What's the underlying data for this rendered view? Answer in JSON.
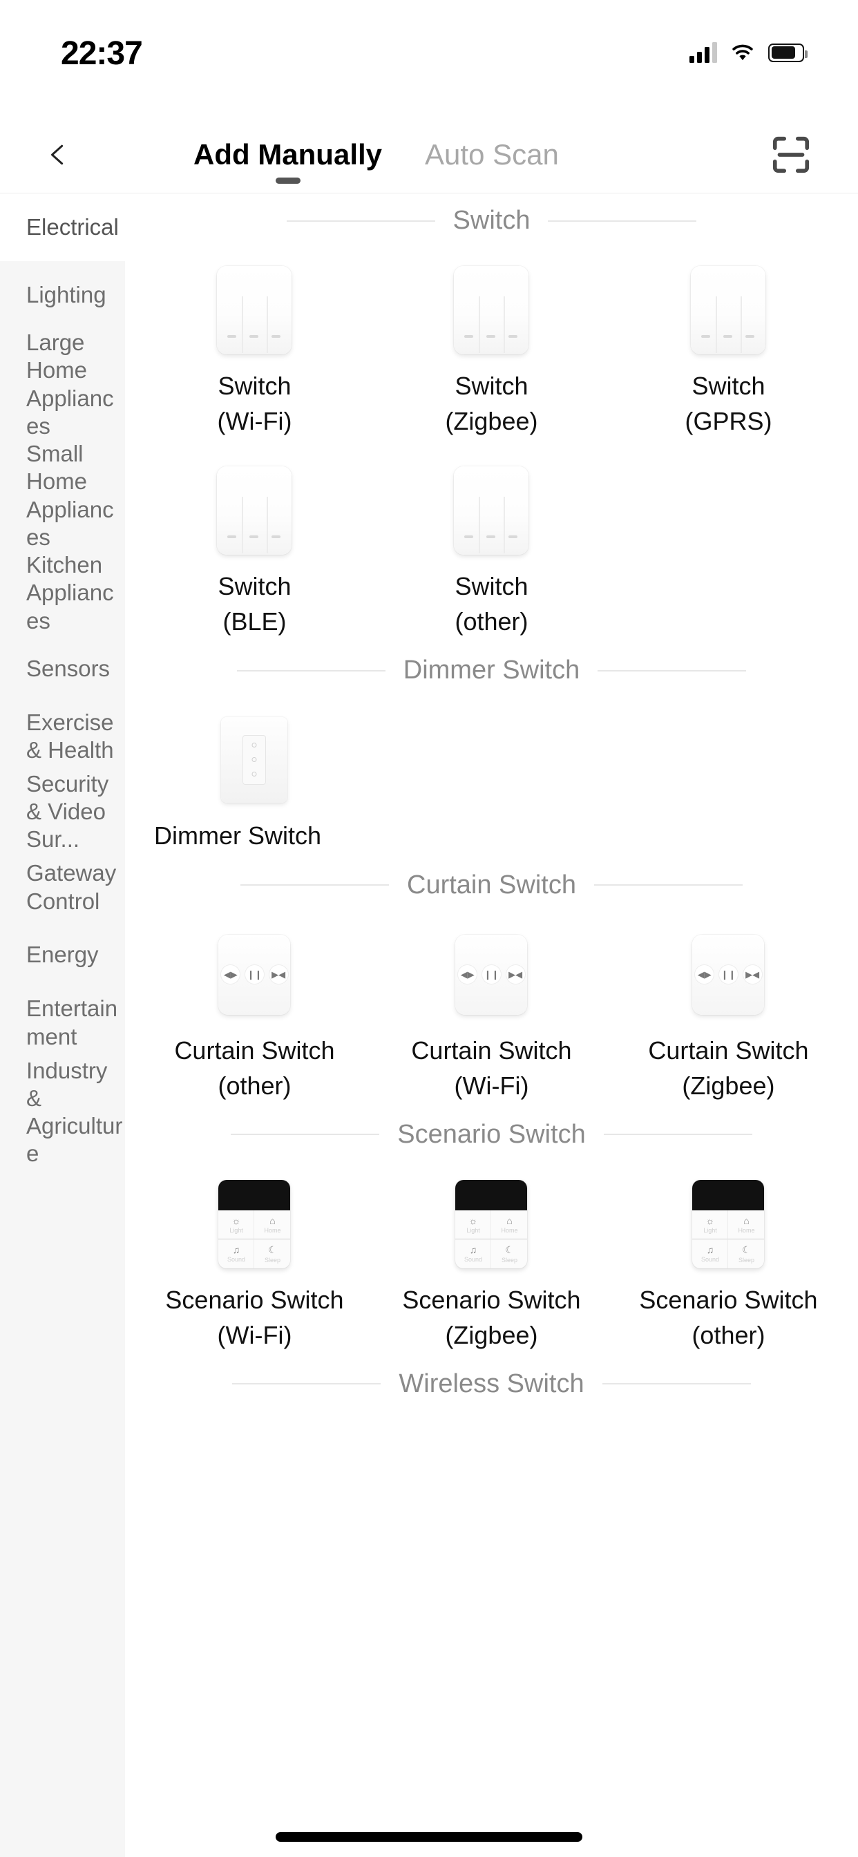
{
  "status_bar": {
    "time": "22:37",
    "icons": [
      "cellular-signal-icon",
      "wifi-icon",
      "battery-icon"
    ]
  },
  "navbar": {
    "back_icon": "chevron-left-icon",
    "scan_icon": "scan-frame-icon",
    "tabs": [
      {
        "label": "Add Manually",
        "active": true
      },
      {
        "label": "Auto Scan",
        "active": false
      }
    ]
  },
  "sidebar": {
    "items": [
      {
        "label": "Electrical",
        "active": true
      },
      {
        "label": "Lighting",
        "active": false
      },
      {
        "label": "Large Home Appliances",
        "active": false
      },
      {
        "label": "Small Home Appliances",
        "active": false
      },
      {
        "label": "Kitchen Appliances",
        "active": false
      },
      {
        "label": "Sensors",
        "active": false
      },
      {
        "label": "Exercise & Health",
        "active": false
      },
      {
        "label": "Security & Video Sur...",
        "active": false
      },
      {
        "label": "Gateway Control",
        "active": false
      },
      {
        "label": "Energy",
        "active": false
      },
      {
        "label": "Entertainment",
        "active": false
      },
      {
        "label": "Industry & Agriculture",
        "active": false
      }
    ]
  },
  "main": {
    "sections": [
      {
        "title": "Switch",
        "icon_kind": "wall-switch",
        "devices": [
          {
            "name": "Switch",
            "variant": "(Wi-Fi)"
          },
          {
            "name": "Switch",
            "variant": "(Zigbee)"
          },
          {
            "name": "Switch",
            "variant": "(GPRS)"
          },
          {
            "name": "Switch",
            "variant": "(BLE)"
          },
          {
            "name": "Switch",
            "variant": "(other)"
          }
        ]
      },
      {
        "title": "Dimmer Switch",
        "icon_kind": "dimmer",
        "devices": [
          {
            "name": "Dimmer Switch",
            "variant": ""
          }
        ]
      },
      {
        "title": "Curtain Switch",
        "icon_kind": "curtain",
        "devices": [
          {
            "name": "Curtain Switch",
            "variant": "(other)"
          },
          {
            "name": "Curtain Switch",
            "variant": "(Wi-Fi)"
          },
          {
            "name": "Curtain Switch",
            "variant": "(Zigbee)"
          }
        ]
      },
      {
        "title": "Scenario Switch",
        "icon_kind": "scenario",
        "devices": [
          {
            "name": "Scenario Switch",
            "variant": "(Wi-Fi)"
          },
          {
            "name": "Scenario Switch",
            "variant": "(Zigbee)"
          },
          {
            "name": "Scenario Switch",
            "variant": "(other)"
          }
        ]
      },
      {
        "title": "Wireless Switch",
        "icon_kind": "wall-switch",
        "devices": []
      }
    ],
    "curtain_buttons": [
      "open-icon",
      "pause-icon",
      "close-icon"
    ],
    "scenario_buttons": [
      {
        "glyph": "☼",
        "label": "Light"
      },
      {
        "glyph": "⌂",
        "label": "Home"
      },
      {
        "glyph": "♫",
        "label": "Sound"
      },
      {
        "glyph": "☾",
        "label": "Sleep"
      }
    ]
  },
  "colors": {
    "sidebar_bg": "#f6f6f6",
    "sidebar_text": "#6e6e6e",
    "section_title": "#8a8a8a",
    "device_label": "#111111",
    "tab_inactive": "#a8a8a8",
    "rule": "#e7e7e7"
  }
}
